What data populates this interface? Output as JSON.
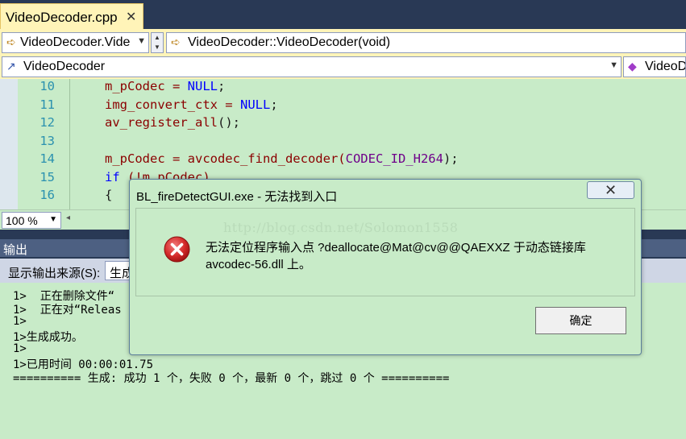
{
  "tab": {
    "title": "VideoDecoder.cpp",
    "close_glyph": "✕"
  },
  "nav": {
    "scope_combo": "VideoDecoder.Vide",
    "function_combo": "VideoDecoder::VideoDecoder(void)",
    "class_combo": "VideoDecoder",
    "member_combo": "VideoD"
  },
  "editor": {
    "lines": [
      {
        "num": "10",
        "code": [
          {
            "t": "m_pCodec = ",
            "c": "ident"
          },
          {
            "t": "NULL",
            "c": "kw-blue"
          },
          {
            "t": ";",
            "c": ""
          }
        ]
      },
      {
        "num": "11",
        "code": [
          {
            "t": "img_convert_ctx = ",
            "c": "ident"
          },
          {
            "t": "NULL",
            "c": "kw-blue"
          },
          {
            "t": ";",
            "c": ""
          }
        ]
      },
      {
        "num": "12",
        "code": [
          {
            "t": "av_register_all",
            "c": "ident"
          },
          {
            "t": "();",
            "c": ""
          }
        ]
      },
      {
        "num": "13",
        "code": []
      },
      {
        "num": "14",
        "code": [
          {
            "t": "m_pCodec = avcodec_find_decoder(",
            "c": "ident"
          },
          {
            "t": "CODEC_ID_H264",
            "c": "purple"
          },
          {
            "t": ");",
            "c": ""
          }
        ]
      },
      {
        "num": "15",
        "code": [
          {
            "t": "if",
            "c": "kw-blue"
          },
          {
            "t": " (!m_pCodec)",
            "c": "ident"
          }
        ]
      },
      {
        "num": "16",
        "code": [
          {
            "t": "{",
            "c": ""
          }
        ]
      }
    ]
  },
  "zoom": {
    "value": "100 %"
  },
  "output": {
    "title": "输出",
    "source_label": "显示输出来源(S):",
    "source_value": "生成",
    "lines": [
      "1>  正在删除文件“",
      "1>  正在对“Releas",
      "1>",
      "1>生成成功。",
      "1>",
      "1>已用时间 00:00:01.75",
      "========== 生成: 成功 1 个，失败 0 个，最新 0 个，跳过 0 个 =========="
    ]
  },
  "dialog": {
    "title": "BL_fireDetectGUI.exe - 无法找到入口",
    "close_glyph": "✕",
    "message_line1": "无法定位程序输入点 ?deallocate@Mat@cv@@QAEXXZ 于动态链接库",
    "message_line2": "avcodec-56.dll 上。",
    "watermark": "http://blog.csdn.net/Solomon1558",
    "ok_label": "确定",
    "icon": "error-icon"
  },
  "colors": {
    "chrome": "#293955",
    "nav_bg": "#fff4b8",
    "editor_bg": "#c8ebc8",
    "line_number": "#2b91af",
    "keyword": "#0000ff",
    "identifier": "#8b0000",
    "macro": "#6f008a",
    "error_red": "#d42a2a"
  }
}
